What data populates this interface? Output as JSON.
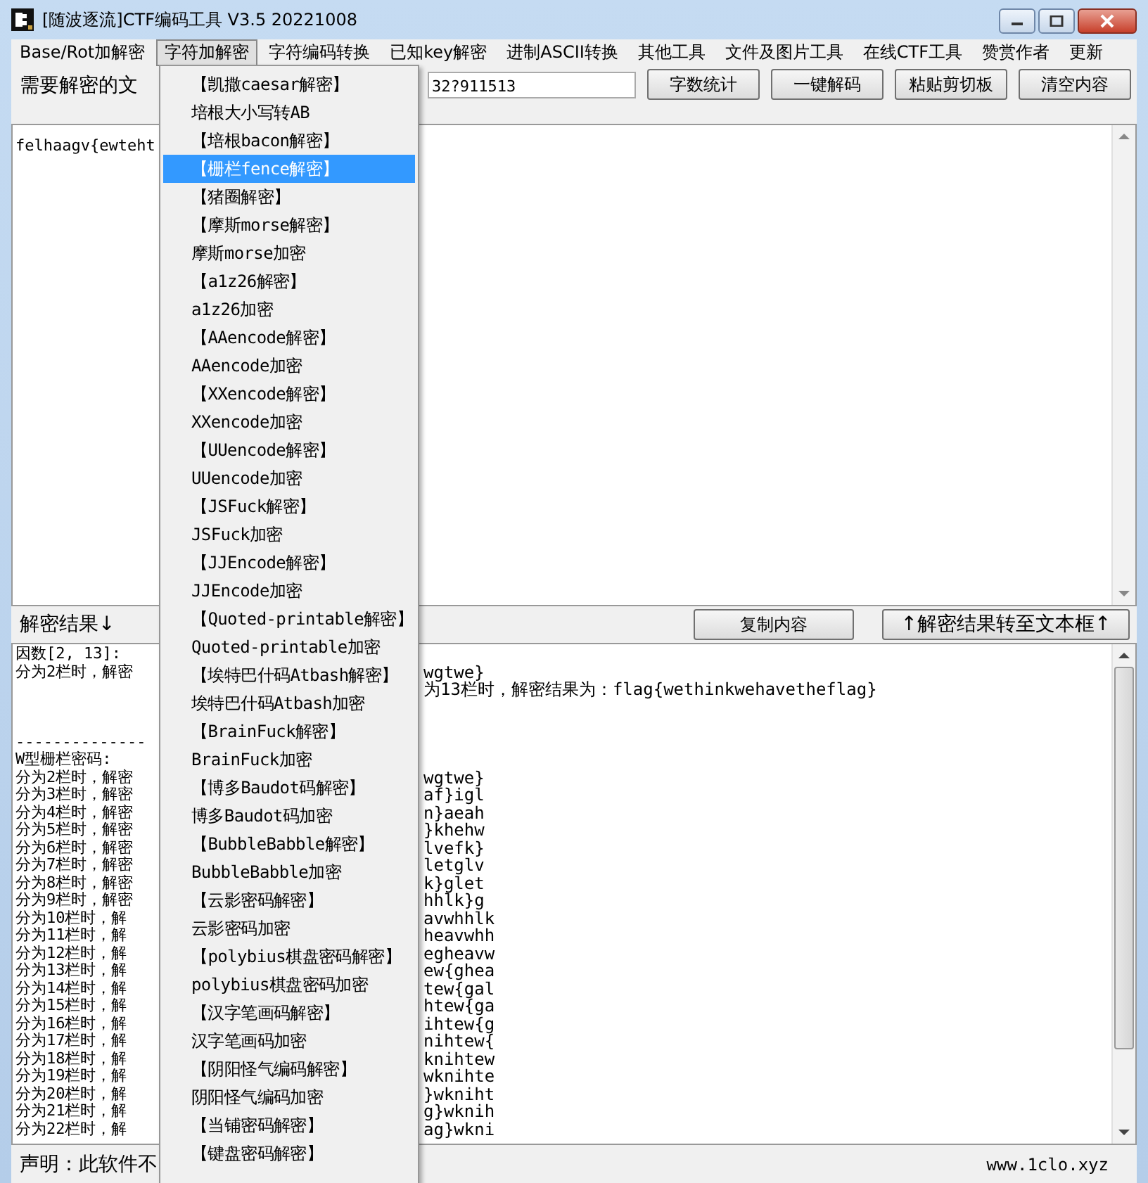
{
  "window": {
    "title": "[随波逐流]CTF编码工具 V3.5 20221008"
  },
  "menubar": [
    {
      "label": "Base/Rot加解密",
      "selected": false
    },
    {
      "label": "字符加解密",
      "selected": true
    },
    {
      "label": "字符编码转换",
      "selected": false
    },
    {
      "label": "已知key解密",
      "selected": false
    },
    {
      "label": "进制ASCII转换",
      "selected": false
    },
    {
      "label": "其他工具",
      "selected": false
    },
    {
      "label": "文件及图片工具",
      "selected": false
    },
    {
      "label": "在线CTF工具",
      "selected": false
    },
    {
      "label": "赞赏作者",
      "selected": false
    },
    {
      "label": "更新",
      "selected": false
    }
  ],
  "toolbar": {
    "label": "需要解密的文",
    "field_value": "32?911513",
    "buttons": [
      "字数统计",
      "一键解码",
      "粘贴剪切板",
      "清空内容"
    ]
  },
  "input_text": "felhaagv{ewteht",
  "result_header": {
    "label": "解密结果↓",
    "buttons": [
      "复制内容",
      "↑解密结果转至文本框↑"
    ]
  },
  "result_lines": [
    {
      "kind": "text",
      "left": "因数[2, 13]:"
    },
    {
      "kind": "text",
      "left": "分为2栏时，解密",
      "right": "wgtwe}"
    },
    {
      "kind": "text",
      "right": "为13栏时，解密结果为：flag{wethinkwehavetheflag}"
    },
    {
      "kind": "blank"
    },
    {
      "kind": "blank"
    },
    {
      "kind": "text",
      "left": "--------------"
    },
    {
      "kind": "text",
      "left": "W型栅栏密码:"
    },
    {
      "kind": "text",
      "left": "分为2栏时，解密",
      "right": "wgtwe}"
    },
    {
      "kind": "text",
      "left": "分为3栏时，解密",
      "right": "af}igl"
    },
    {
      "kind": "text",
      "left": "分为4栏时，解密",
      "right": "n}aeah"
    },
    {
      "kind": "text",
      "left": "分为5栏时，解密",
      "right": "}khehw"
    },
    {
      "kind": "text",
      "left": "分为6栏时，解密",
      "right": "lvefk}"
    },
    {
      "kind": "text",
      "left": "分为7栏时，解密",
      "right": "letglv"
    },
    {
      "kind": "text",
      "left": "分为8栏时，解密",
      "right": "k}glet"
    },
    {
      "kind": "text",
      "left": "分为9栏时，解密",
      "right": "hhlk}g"
    },
    {
      "kind": "text",
      "left": "分为10栏时，解",
      "right": "avwhhlk"
    },
    {
      "kind": "text",
      "left": "分为11栏时，解",
      "right": "heavwhh"
    },
    {
      "kind": "text",
      "left": "分为12栏时，解",
      "right": "egheavw"
    },
    {
      "kind": "text",
      "left": "分为13栏时，解",
      "right": "ew{ghea"
    },
    {
      "kind": "text",
      "left": "分为14栏时，解",
      "right": "tew{gal"
    },
    {
      "kind": "text",
      "left": "分为15栏时，解",
      "right": "htew{ga"
    },
    {
      "kind": "text",
      "left": "分为16栏时，解",
      "right": "ihtew{g"
    },
    {
      "kind": "text",
      "left": "分为17栏时，解",
      "right": "nihtew{"
    },
    {
      "kind": "text",
      "left": "分为18栏时，解",
      "right": "knihtew"
    },
    {
      "kind": "text",
      "left": "分为19栏时，解",
      "right": "wknihte"
    },
    {
      "kind": "text",
      "left": "分为20栏时，解",
      "right": "}wkniht"
    },
    {
      "kind": "text",
      "left": "分为21栏时，解",
      "right": "g}wknih"
    },
    {
      "kind": "text",
      "left": "分为22栏时，解",
      "right": "ag}wkni"
    }
  ],
  "status_bar": {
    "left": "声明：此软件不",
    "right": "www.1clo.xyz"
  },
  "dropdown": [
    {
      "label": "【凯撒caesar解密】",
      "selected": false
    },
    {
      "label": "培根大小写转AB",
      "selected": false
    },
    {
      "label": "【培根bacon解密】",
      "selected": false
    },
    {
      "label": "【栅栏fence解密】",
      "selected": true
    },
    {
      "label": "【猪圈解密】",
      "selected": false
    },
    {
      "label": "【摩斯morse解密】",
      "selected": false
    },
    {
      "label": "摩斯morse加密",
      "selected": false
    },
    {
      "label": "【a1z26解密】",
      "selected": false
    },
    {
      "label": "a1z26加密",
      "selected": false
    },
    {
      "label": "【AAencode解密】",
      "selected": false
    },
    {
      "label": "AAencode加密",
      "selected": false
    },
    {
      "label": "【XXencode解密】",
      "selected": false
    },
    {
      "label": "XXencode加密",
      "selected": false
    },
    {
      "label": "【UUencode解密】",
      "selected": false
    },
    {
      "label": "UUencode加密",
      "selected": false
    },
    {
      "label": "【JSFuck解密】",
      "selected": false
    },
    {
      "label": "JSFuck加密",
      "selected": false
    },
    {
      "label": "【JJEncode解密】",
      "selected": false
    },
    {
      "label": "JJEncode加密",
      "selected": false
    },
    {
      "label": "【Quoted-printable解密】",
      "selected": false
    },
    {
      "label": "Quoted-printable加密",
      "selected": false
    },
    {
      "label": "【埃特巴什码Atbash解密】",
      "selected": false
    },
    {
      "label": "埃特巴什码Atbash加密",
      "selected": false
    },
    {
      "label": "【BrainFuck解密】",
      "selected": false
    },
    {
      "label": "BrainFuck加密",
      "selected": false
    },
    {
      "label": "【博多Baudot码解密】",
      "selected": false
    },
    {
      "label": "博多Baudot码加密",
      "selected": false
    },
    {
      "label": "【BubbleBabble解密】",
      "selected": false
    },
    {
      "label": "BubbleBabble加密",
      "selected": false
    },
    {
      "label": "【云影密码解密】",
      "selected": false
    },
    {
      "label": "云影密码加密",
      "selected": false
    },
    {
      "label": "【polybius棋盘密码解密】",
      "selected": false
    },
    {
      "label": "polybius棋盘密码加密",
      "selected": false
    },
    {
      "label": "【汉字笔画码解密】",
      "selected": false
    },
    {
      "label": "汉字笔画码加密",
      "selected": false
    },
    {
      "label": "【阴阳怪气编码解密】",
      "selected": false
    },
    {
      "label": "阴阳怪气编码加密",
      "selected": false
    },
    {
      "label": "【当铺密码解密】",
      "selected": false
    },
    {
      "label": "【键盘密码解密】",
      "selected": false
    }
  ]
}
